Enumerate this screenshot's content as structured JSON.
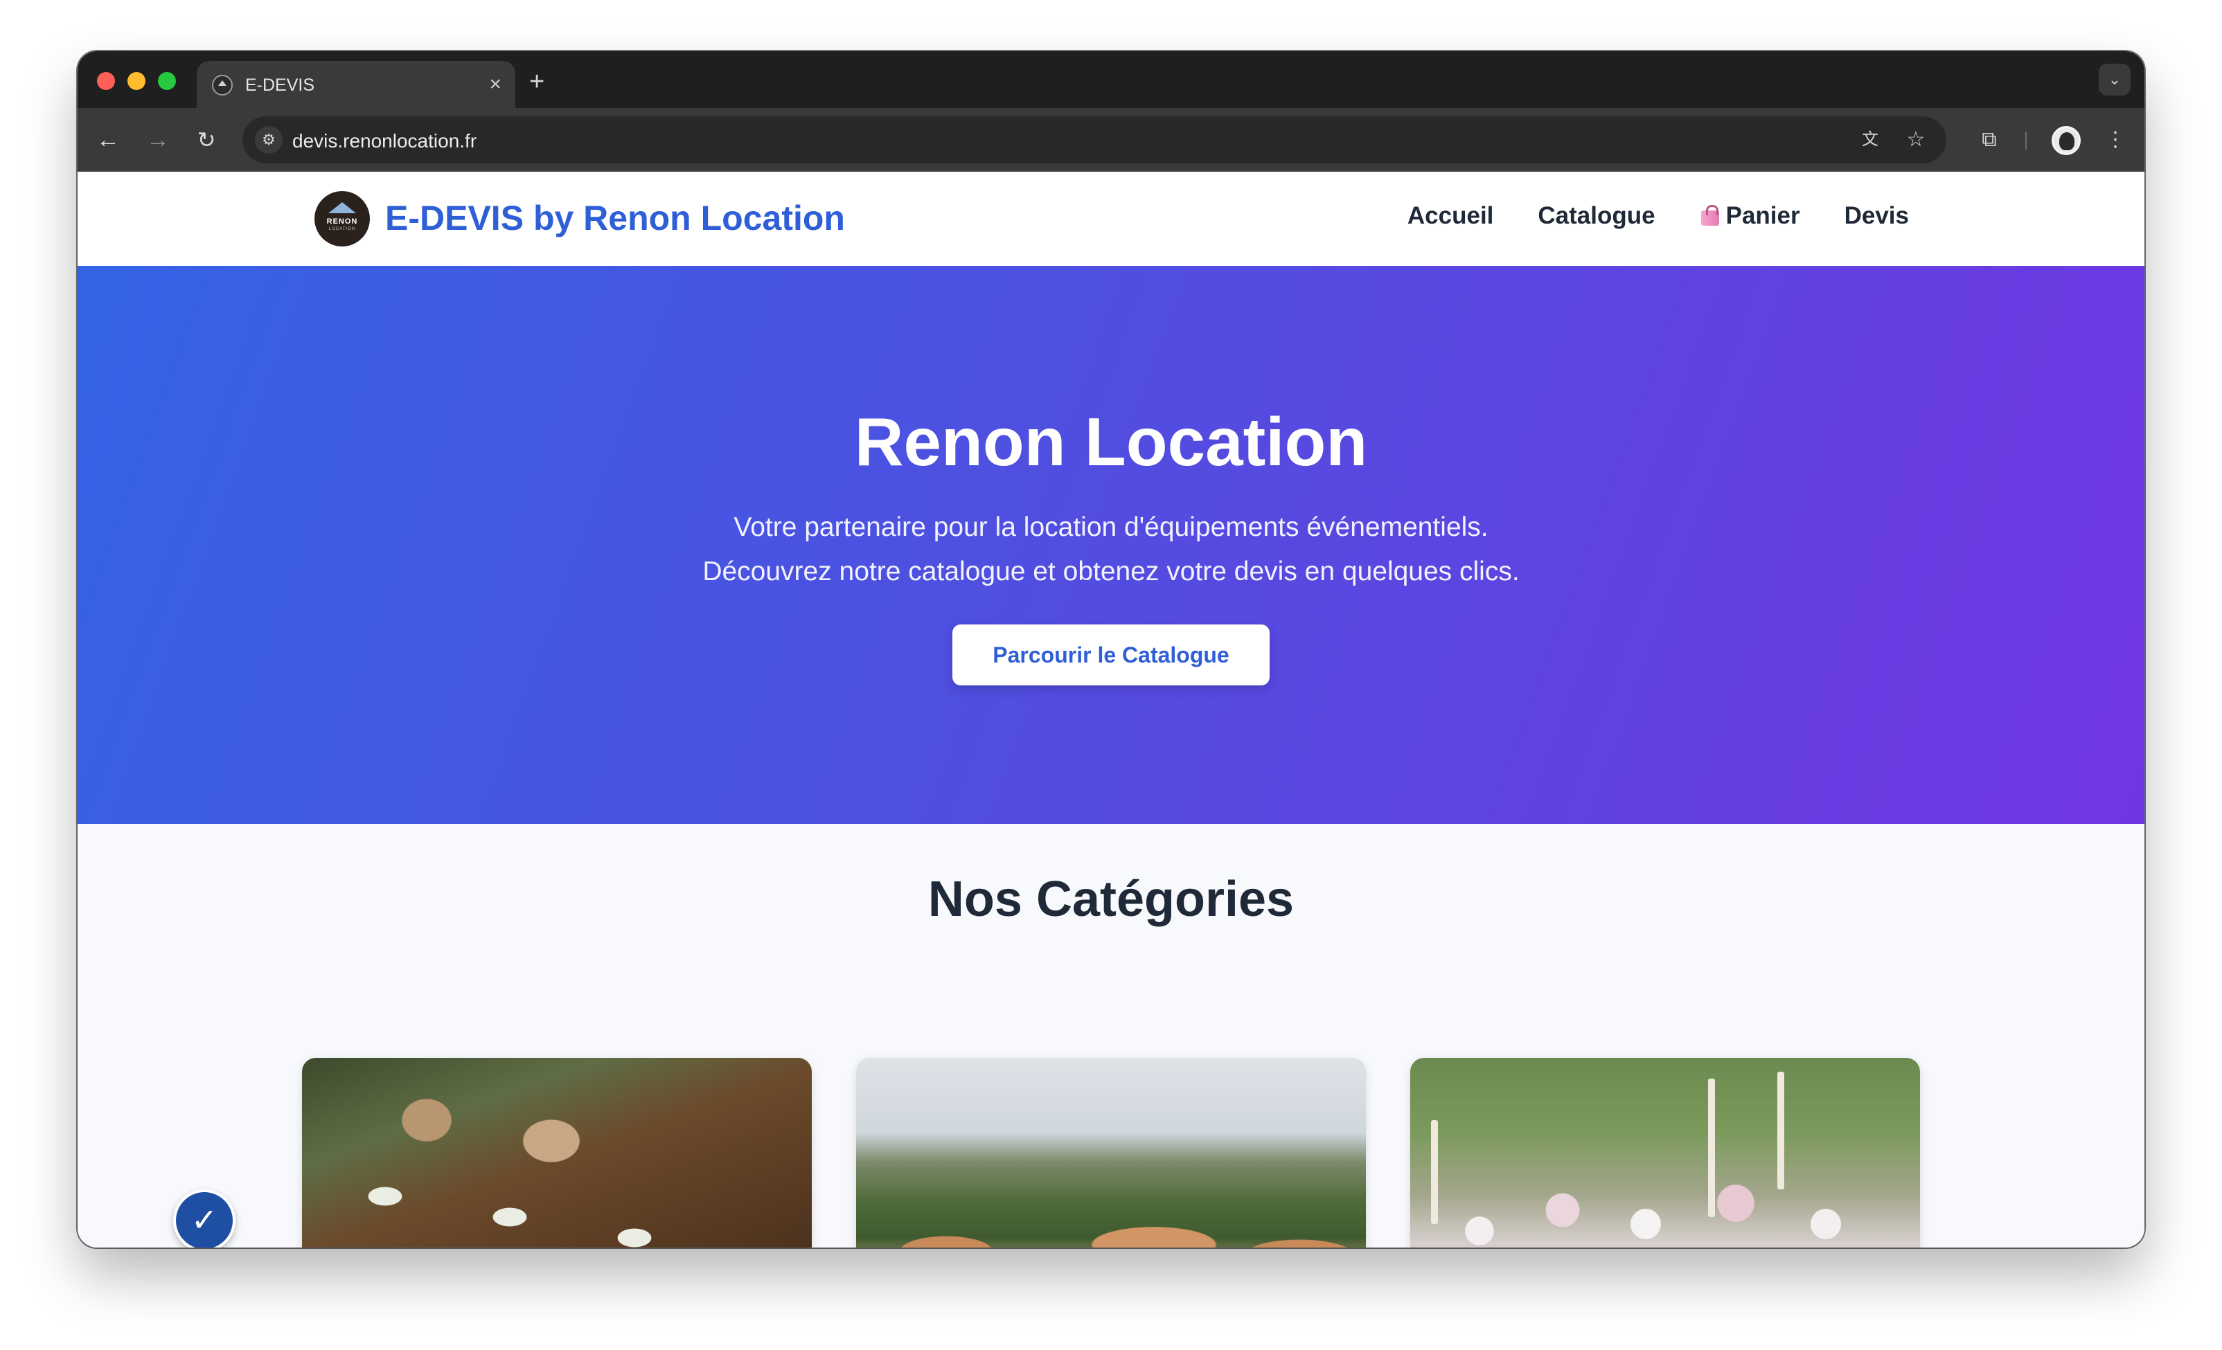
{
  "browser": {
    "tab_title": "E-DEVIS",
    "tab_close": "×",
    "new_tab": "+",
    "url": "devis.renonlocation.fr",
    "icons": [
      "back-arrow-icon",
      "forward-arrow-icon",
      "reload-icon",
      "site-info-icon",
      "translate-icon",
      "star-icon",
      "extensions-icon",
      "profile-avatar",
      "kebab-menu-icon",
      "tab-search-icon"
    ]
  },
  "header": {
    "logo_text": "RENON",
    "logo_sub": "LOCATION",
    "brand": "E-DEVIS by Renon Location",
    "nav": {
      "home": "Accueil",
      "catalog": "Catalogue",
      "cart": "Panier",
      "quotes": "Devis"
    }
  },
  "hero": {
    "title": "Renon Location",
    "line1": "Votre partenaire pour la location d'équipements événementiels.",
    "line2": "Découvrez notre catalogue et obtenez votre devis en quelques clics.",
    "cta": "Parcourir le Catalogue"
  },
  "categories": {
    "title": "Nos Catégories"
  },
  "colors": {
    "brand_blue": "#2f5fd6",
    "hero_gradient_start": "#3563e6",
    "hero_gradient_end": "#7136e2",
    "accessibility_button": "#1e4fa3"
  }
}
